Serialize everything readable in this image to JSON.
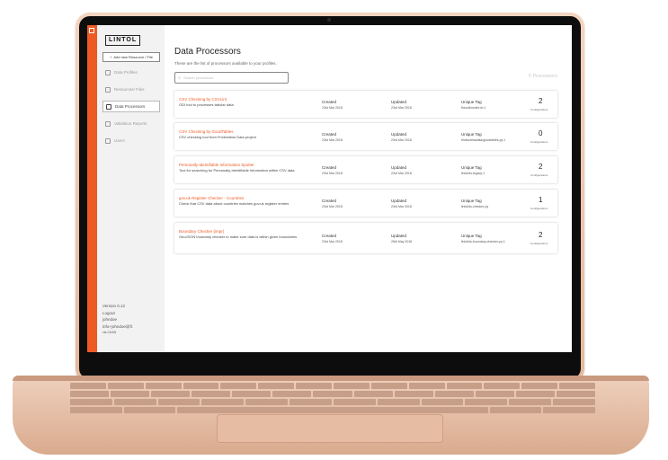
{
  "app": {
    "logo": "LINTOL",
    "add_button": "Add new Resource / File",
    "nav": [
      {
        "label": "Data Profiles",
        "icon": "database-icon"
      },
      {
        "label": "Resources/ Files",
        "icon": "files-icon"
      },
      {
        "label": "Data Processors",
        "icon": "processor-icon"
      },
      {
        "label": "Validation Reports",
        "icon": "report-icon"
      },
      {
        "label": "Users",
        "icon": "users-icon"
      }
    ],
    "active_nav": "Data Processors",
    "version": "Version 0.12",
    "logout": "Logout",
    "user_name": "johndoe",
    "user_email": "info+johndoe@fl.",
    "via": "via CKAN",
    "accent_color": "#ee5a24"
  },
  "page": {
    "title": "Data Processors",
    "subtitle": "These are the list of processors available to your profiles.",
    "search_placeholder": "Search processors",
    "count": "5 Processors"
  },
  "processors": [
    {
      "name": "CSV Checking by CSVLint",
      "description": "ODI tool to processes tabular data",
      "created_label": "Created",
      "created": "23rd Mar 2018",
      "updated_label": "Updated",
      "updated": "23rd Mar 2018",
      "tag_label": "Unique Tag",
      "tag": "theodi/csvlint.rb:1",
      "configs": "2",
      "configs_label": "Configurations"
    },
    {
      "name": "CSV Checking by GoodTables",
      "description": "CSV checking tool from Frictionless Data project",
      "created_label": "Created",
      "created": "23rd Mar 2018",
      "updated_label": "Updated",
      "updated": "23rd Mar 2018",
      "tag_label": "Unique Tag",
      "tag": "frictionlessdata/goodtables-py:1",
      "configs": "0",
      "configs_label": "Configurations"
    },
    {
      "name": "Personally-Identifiable Information Spotter",
      "description": "Tool for searching for Personally-Identifiable Information within CSV data",
      "created_label": "Created",
      "created": "23rd Mar 2018",
      "updated_label": "Updated",
      "updated": "23rd Mar 2018",
      "tag_label": "Unique Tag",
      "tag": "lintol/ds-legacy:1",
      "configs": "2",
      "configs_label": "Configurations"
    },
    {
      "name": "gov.uk Register Checker - Countries",
      "description": "Check that CSV data about countries matches gov.uk register entries",
      "created_label": "Created",
      "created": "23rd Mar 2018",
      "updated_label": "Updated",
      "updated": "23rd Mar 2018",
      "tag_label": "Unique Tag",
      "tag": "lintol/ds-checker-py",
      "configs": "1",
      "configs_label": "Configurations"
    },
    {
      "name": "Boundary Checker (impr)",
      "description": "GeoJSON boundary checker to make sure data is within given boundaries",
      "created_label": "Created",
      "created": "23rd Mar 2018",
      "updated_label": "Updated",
      "updated": "26th May 2018",
      "tag_label": "Unique Tag",
      "tag": "lintol/ds-boundary-checker-py:1",
      "configs": "2",
      "configs_label": "Configurations"
    }
  ]
}
